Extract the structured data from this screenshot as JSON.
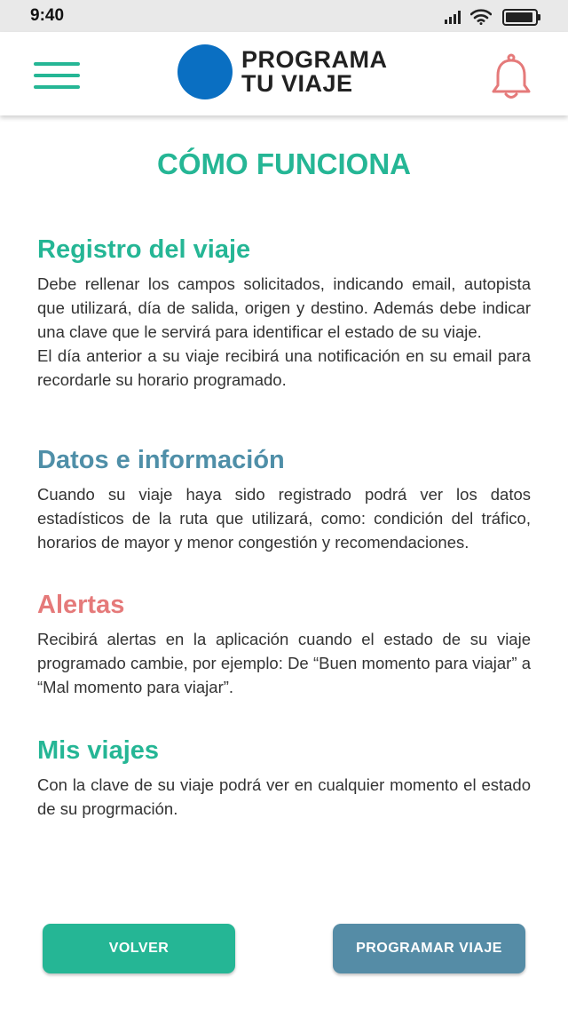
{
  "status_bar": {
    "time": "9:40"
  },
  "header": {
    "logo_line1": "PROGRAMA",
    "logo_line2": "TU VIAJE",
    "icons": {
      "menu": "hamburger-menu-icon",
      "notifications": "bell-icon"
    }
  },
  "page": {
    "title": "CÓMO FUNCIONA"
  },
  "sections": [
    {
      "heading": "Registro del viaje",
      "paragraphs": [
        "Debe rellenar los campos solicitados, indicando email, autopista que utilizará, día de salida, origen y destino. Además debe indicar una clave que le servirá para identificar el estado de su viaje.",
        "El día anterior a su viaje recibirá una notificación en su email para recordarle su horario programado."
      ]
    },
    {
      "heading": "Datos e información",
      "paragraphs": [
        "Cuando su viaje haya sido registrado podrá ver los datos estadísticos de la ruta que utilizará, como: condición del tráfico, horarios de mayor y menor congestión y recomendaciones."
      ]
    },
    {
      "heading": "Alertas",
      "paragraphs": [
        "Recibirá alertas en la aplicación cuando el estado de su viaje programado cambie, por ejemplo: De “Buen momento para viajar” a  “Mal momento para viajar”."
      ]
    },
    {
      "heading": "Mis viajes",
      "paragraphs": [
        "Con la clave de su viaje podrá ver en cualquier momento el estado de su progrmación."
      ]
    }
  ],
  "buttons": {
    "back": "VOLVER",
    "program": "PROGRAMAR VIAJE"
  },
  "colors": {
    "accent_green": "#25b695",
    "accent_blue": "#4f8fa8",
    "accent_red": "#e57a7a",
    "logo_blue": "#0a6fc2",
    "button_blue": "#558ca6"
  }
}
